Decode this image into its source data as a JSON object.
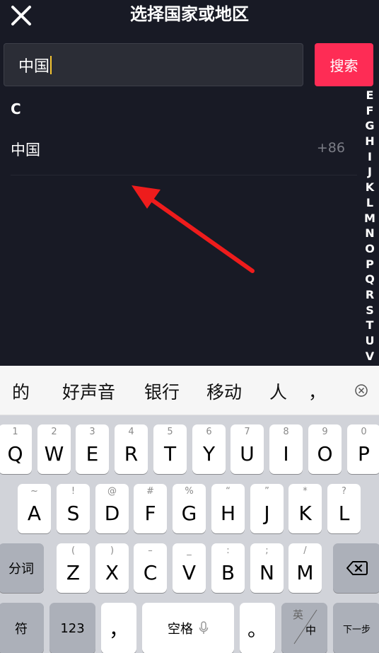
{
  "header": {
    "title": "选择国家或地区"
  },
  "search": {
    "value": "中国",
    "button_label": "搜索"
  },
  "list": {
    "section_letter": "C",
    "items": [
      {
        "name": "中国",
        "code": "+86"
      }
    ]
  },
  "alphabet_index": [
    "E",
    "F",
    "G",
    "H",
    "I",
    "J",
    "K",
    "L",
    "M",
    "N",
    "O",
    "P",
    "Q",
    "R",
    "S",
    "T",
    "U",
    "V"
  ],
  "candidates": [
    "的",
    "好声音",
    "银行",
    "移动",
    "人",
    "，"
  ],
  "keyboard": {
    "row1": [
      {
        "hint": "1",
        "key": "Q"
      },
      {
        "hint": "2",
        "key": "W"
      },
      {
        "hint": "3",
        "key": "E"
      },
      {
        "hint": "4",
        "key": "R"
      },
      {
        "hint": "5",
        "key": "T"
      },
      {
        "hint": "6",
        "key": "Y"
      },
      {
        "hint": "7",
        "key": "U"
      },
      {
        "hint": "8",
        "key": "I"
      },
      {
        "hint": "9",
        "key": "O"
      },
      {
        "hint": "0",
        "key": "P"
      }
    ],
    "row2": [
      {
        "hint": "~",
        "key": "A"
      },
      {
        "hint": "!",
        "key": "S"
      },
      {
        "hint": "@",
        "key": "D"
      },
      {
        "hint": "#",
        "key": "F"
      },
      {
        "hint": "%",
        "key": "G"
      },
      {
        "hint": "“",
        "key": "H"
      },
      {
        "hint": "”",
        "key": "J"
      },
      {
        "hint": "*",
        "key": "K"
      },
      {
        "hint": "?",
        "key": "L"
      }
    ],
    "row3": [
      {
        "hint": "(",
        "key": "Z"
      },
      {
        "hint": ")",
        "key": "X"
      },
      {
        "hint": "–",
        "key": "C"
      },
      {
        "hint": "_",
        "key": "V"
      },
      {
        "hint": ":",
        "key": "B"
      },
      {
        "hint": ";",
        "key": "N"
      },
      {
        "hint": "/",
        "key": "M"
      }
    ],
    "fenci_label": "分词",
    "symbol_label": "符",
    "numbers_label": "123",
    "comma_label": "，",
    "space_label": "空格",
    "period_label": "。",
    "en_label": "英",
    "zh_label": "中",
    "next_label": "下一步"
  },
  "colors": {
    "background": "#181a25",
    "search_button": "#fe2c55",
    "caret": "#f5c431",
    "arrow": "#ee1c1c"
  }
}
